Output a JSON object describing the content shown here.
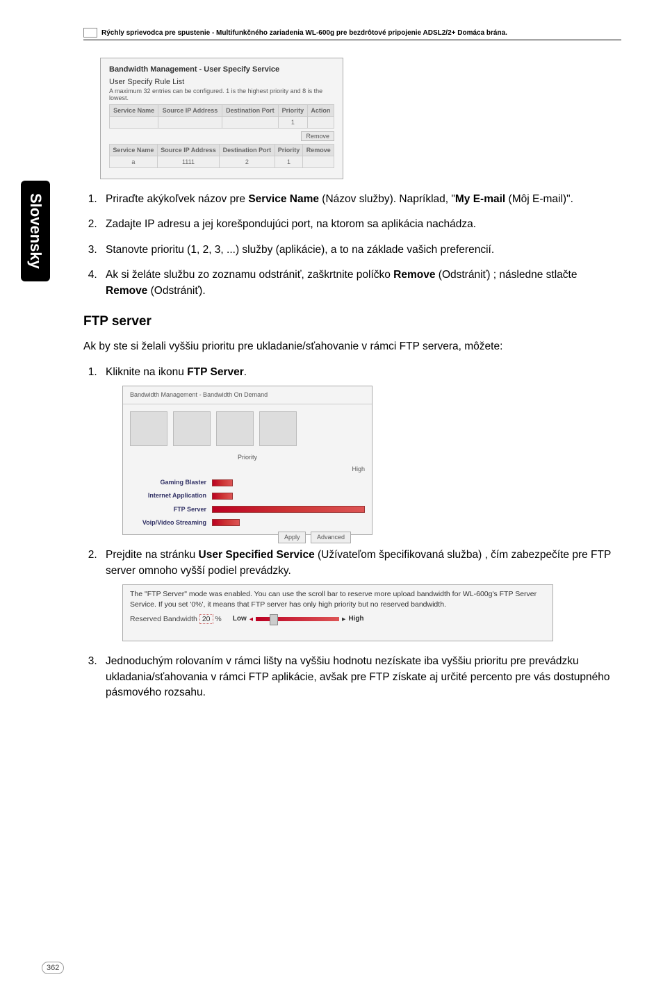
{
  "language_tab": "Slovensky",
  "header": "Rýchly sprievodca pre spustenie - Multifunkčného zariadenia WL-600g pre bezdrôtové pripojenie ADSL2/2+ Domáca brána.",
  "table1": {
    "title": "Bandwidth Management - User Specify Service",
    "caption": "User Specify Rule List",
    "desc": "A maximum 32 entries can be configured. 1 is the highest priority and 8 is the lowest.",
    "headers1": [
      "Service Name",
      "Source IP Address",
      "Destination Port",
      "Priority",
      "Action"
    ],
    "row1": [
      "",
      "",
      "",
      "1",
      ""
    ],
    "btn1": "Remove",
    "headers2": [
      "Service Name",
      "Source IP Address",
      "Destination Port",
      "Priority",
      "Remove"
    ],
    "row2": [
      "a",
      "1111",
      "2",
      "1",
      ""
    ]
  },
  "steps_a": {
    "s1_pre": "Priraďte akýkoľvek názov pre ",
    "s1_b1": "Service Name",
    "s1_mid1": " (Názov služby). Napríklad, \"",
    "s1_b2": "My E-mail",
    "s1_post": " (Môj E-mail)\".",
    "s2": "Zadajte IP adresu a jej korešpondujúci port, na ktorom sa aplikácia nachádza.",
    "s3": "Stanovte prioritu (1, 2, 3, ...) služby (aplikácie), a to na základe vašich preferencií.",
    "s4_pre": "Ak si želáte službu zo zoznamu odstrániť, zaškrtnite políčko ",
    "s4_b1": "Remove",
    "s4_mid1": " (Odstrániť) ; následne stlačte ",
    "s4_b2": "Remove",
    "s4_post": " (Odstrániť)."
  },
  "ftp_heading": "FTP server",
  "ftp_intro": "Ak by ste si želali vyššiu prioritu pre ukladanie/sťahovanie v rámci FTP servera, môžete:",
  "steps_b": {
    "s1_pre": "Kliknite na ikonu ",
    "s1_b": "FTP Server",
    "s1_post": ".",
    "s2_pre": "Prejdite na stránku ",
    "s2_b": "User Specified Service",
    "s2_post": " (Užívateľom špecifikovaná služba) , čím zabezpečíte pre FTP server omnoho vyšší podiel prevádzky.",
    "s3": "Jednoduchým rolovaním v rámci lišty na vyššiu hodnotu nezískate iba vyššiu prioritu pre prevádzku ukladania/sťahovania v rámci FTP aplikácie, avšak pre FTP získate aj určité percento pre vás dostupného pásmového rozsahu."
  },
  "icons_panel": {
    "title": "Bandwidth Management - Bandwidth On Demand",
    "priority_label": "Priority",
    "high": "High",
    "rows": [
      "Gaming Blaster",
      "Internet Application",
      "FTP Server",
      "Voip/Video Streaming"
    ],
    "btn_apply": "Apply",
    "btn_advanced": "Advanced"
  },
  "slider_panel": {
    "desc": "The \"FTP Server\" mode was enabled. You can use the scroll bar to reserve more upload bandwidth for WL-600g's FTP Server Service. If you set '0%', it means that FTP server has only high priority but no reserved bandwidth.",
    "low": "Low",
    "high": "High",
    "reserved_label": "Reserved Bandwidth",
    "reserved_value": "20",
    "pct": "%",
    "cap": ""
  },
  "page_number": "362"
}
